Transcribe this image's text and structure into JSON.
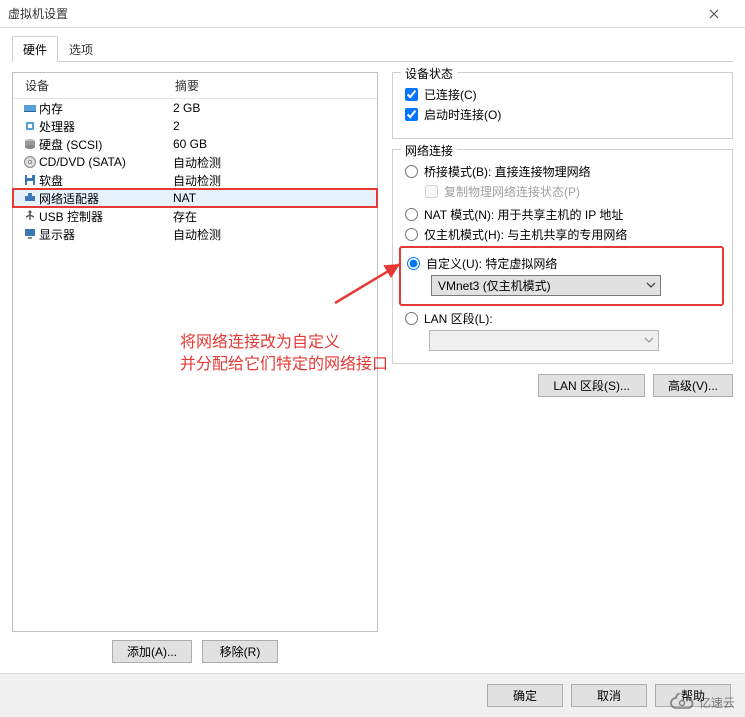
{
  "title": "虚拟机设置",
  "tabs": {
    "hardware": "硬件",
    "options": "选项"
  },
  "device_headers": {
    "device": "设备",
    "summary": "摘要"
  },
  "devices": [
    {
      "icon": "memory",
      "name": "内存",
      "summary": "2 GB"
    },
    {
      "icon": "cpu",
      "name": "处理器",
      "summary": "2"
    },
    {
      "icon": "disk",
      "name": "硬盘 (SCSI)",
      "summary": "60 GB"
    },
    {
      "icon": "cd",
      "name": "CD/DVD (SATA)",
      "summary": "自动检测"
    },
    {
      "icon": "floppy",
      "name": "软盘",
      "summary": "自动检测"
    },
    {
      "icon": "net",
      "name": "网络适配器",
      "summary": "NAT"
    },
    {
      "icon": "usb",
      "name": "USB 控制器",
      "summary": "存在"
    },
    {
      "icon": "display",
      "name": "显示器",
      "summary": "自动检测"
    }
  ],
  "selected_device_index": 5,
  "left_buttons": {
    "add": "添加(A)...",
    "remove": "移除(R)"
  },
  "status_group": {
    "title": "设备状态",
    "connected": "已连接(C)",
    "connect_at_power_on": "启动时连接(O)",
    "connected_checked": true,
    "connect_power_checked": true
  },
  "net_group": {
    "title": "网络连接",
    "bridged": "桥接模式(B): 直接连接物理网络",
    "replicate": "复制物理网络连接状态(P)",
    "nat": "NAT 模式(N): 用于共享主机的 IP 地址",
    "hostonly": "仅主机模式(H): 与主机共享的专用网络",
    "custom": "自定义(U): 特定虚拟网络",
    "custom_select": "VMnet3 (仅主机模式)",
    "lan": "LAN 区段(L):",
    "selected": "custom"
  },
  "right_buttons": {
    "lan_segments": "LAN 区段(S)...",
    "advanced": "高级(V)..."
  },
  "footer": {
    "ok": "确定",
    "cancel": "取消",
    "help": "帮助"
  },
  "annotation": {
    "line1": "将网络连接改为自定义",
    "line2": "并分配给它们特定的网络接口"
  },
  "watermark": "亿速云"
}
